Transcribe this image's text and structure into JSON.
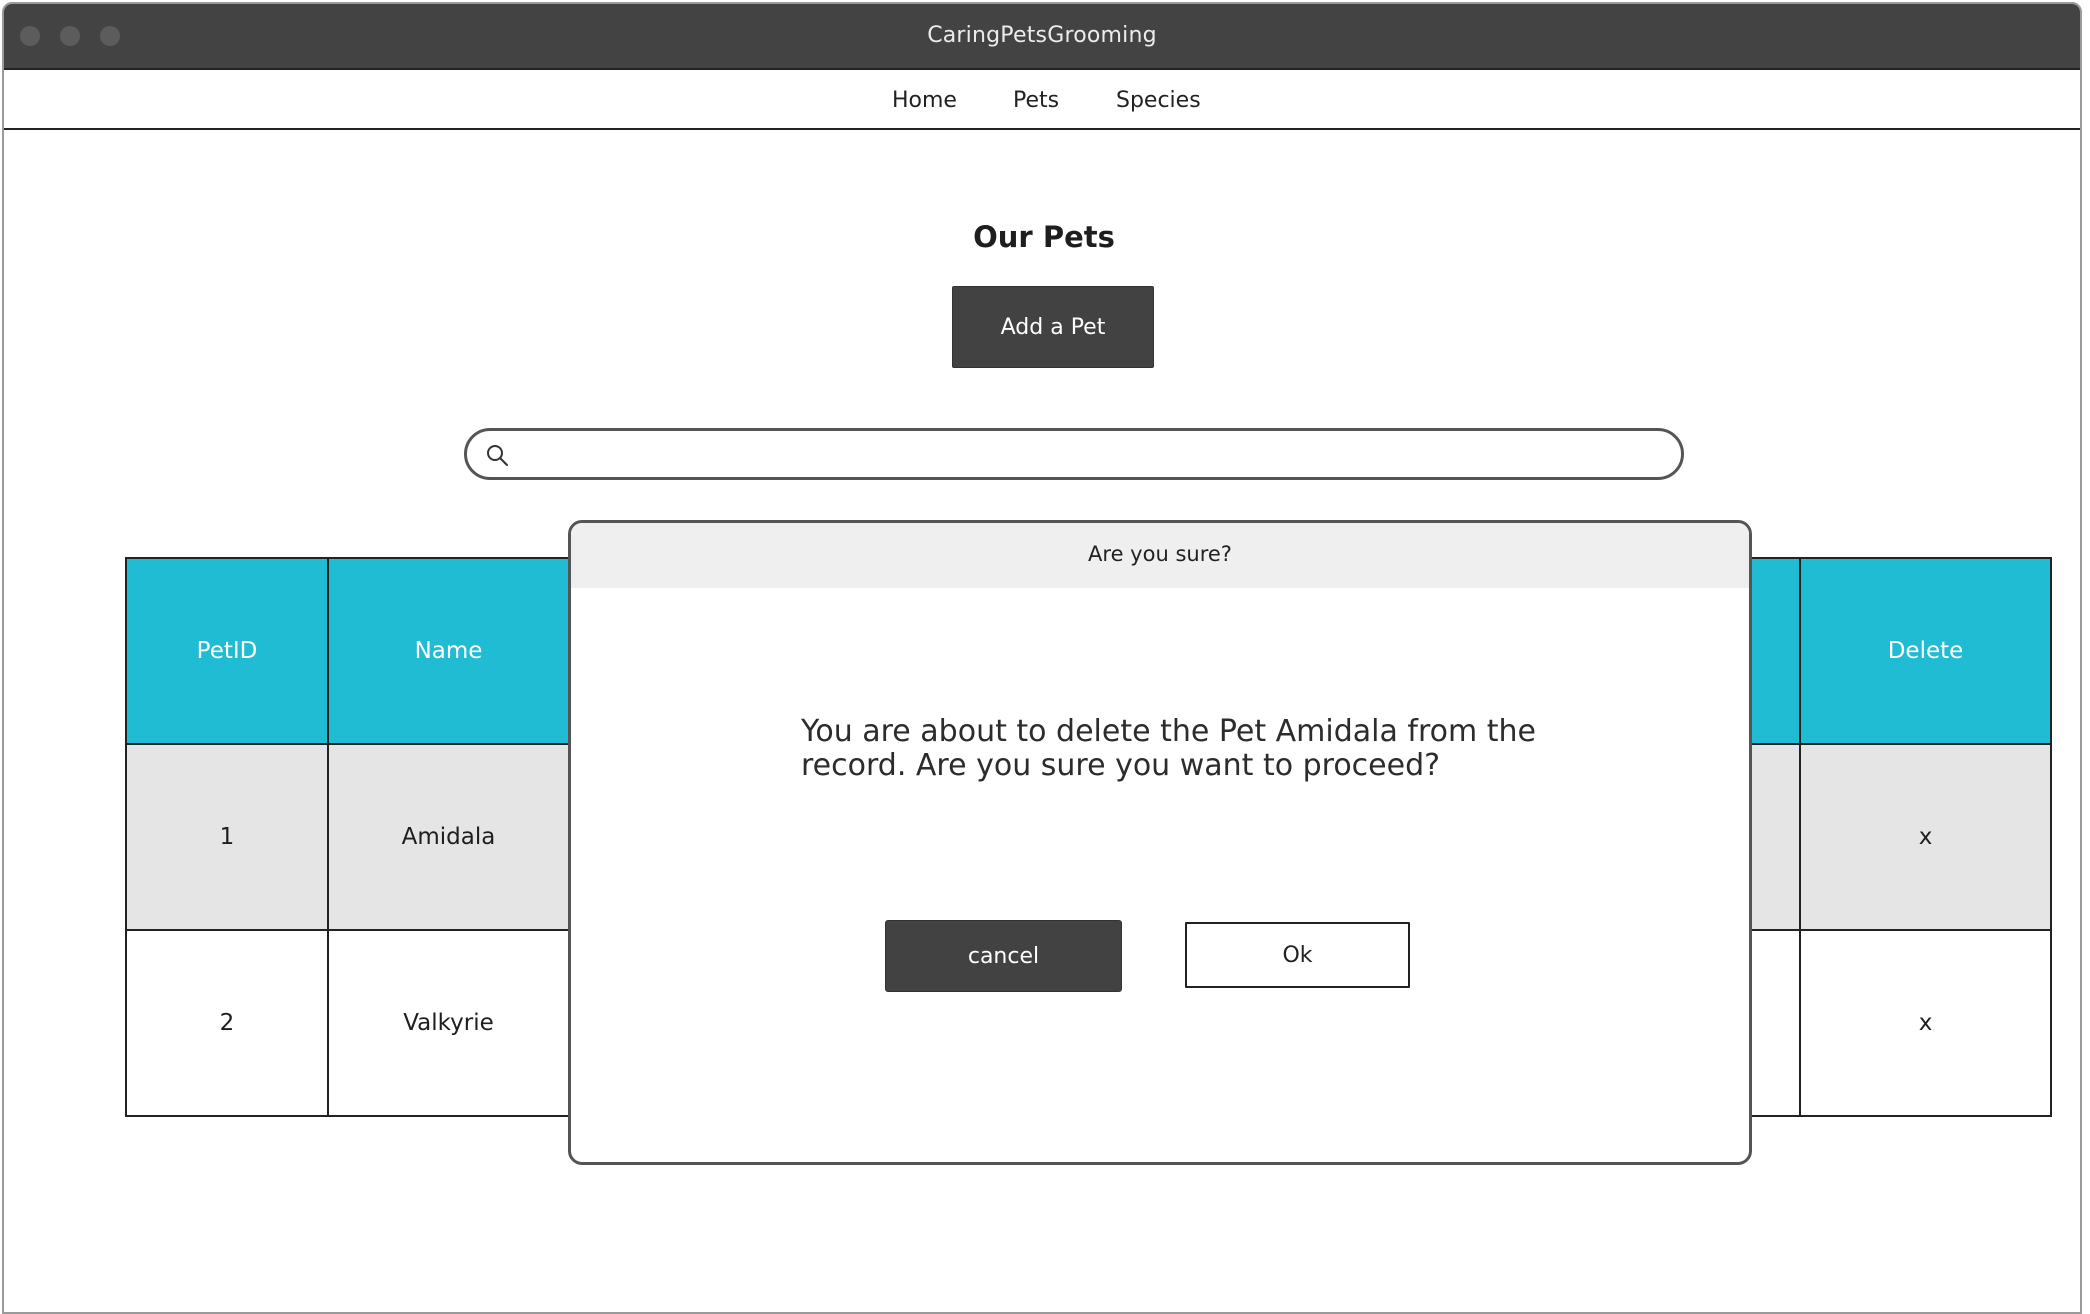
{
  "window": {
    "title": "CaringPetsGrooming"
  },
  "nav": {
    "items": [
      {
        "label": "Home"
      },
      {
        "label": "Pets"
      },
      {
        "label": "Species"
      }
    ]
  },
  "main": {
    "page_title": "Our Pets",
    "add_button_label": "Add a Pet",
    "search": {
      "value": "",
      "placeholder": ""
    }
  },
  "table": {
    "headers": [
      "PetID",
      "Name",
      "Delete"
    ],
    "rows": [
      {
        "id": "1",
        "name": "Amidala",
        "delete": "x"
      },
      {
        "id": "2",
        "name": "Valkyrie",
        "delete": "x"
      }
    ]
  },
  "modal": {
    "title": "Are you sure?",
    "message": "You are about to delete  the Pet Amidala from the record. Are you sure you want to proceed?",
    "cancel_label": "cancel",
    "ok_label": "Ok"
  },
  "colors": {
    "titlebar": "#434343",
    "header_cell": "#1fbcd3",
    "odd_row": "#e5e5e5",
    "dark_button": "#424242"
  },
  "icons": {
    "search": "search-icon"
  }
}
